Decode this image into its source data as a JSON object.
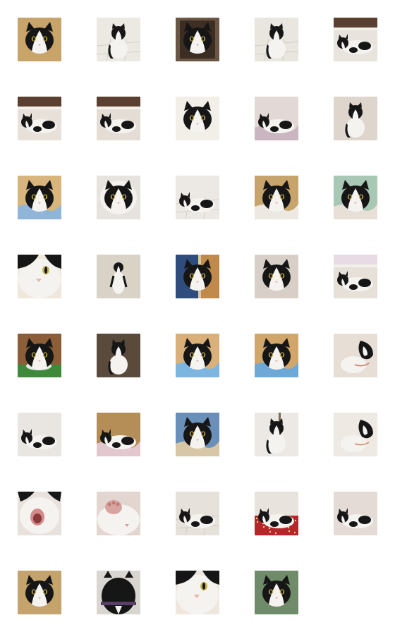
{
  "grid": {
    "columns": 5,
    "rows": 8,
    "items": [
      {
        "id": 1,
        "scene": "bg",
        "bg": "#c9a46a",
        "cat": "face",
        "accent": "#d9462f"
      },
      {
        "id": 2,
        "scene": "tile",
        "bg": "#ece8e2",
        "cat": "sit",
        "accent": "#6b5a49"
      },
      {
        "id": 3,
        "scene": "box",
        "bg": "#6a5645",
        "cat": "face",
        "accent": "#8f7457"
      },
      {
        "id": 4,
        "scene": "tile",
        "bg": "#e9e5df",
        "cat": "sit",
        "accent": "#b32d2d"
      },
      {
        "id": 5,
        "scene": "wall",
        "bg": "#e8e3dd",
        "cat": "lie",
        "accent": "#5b3f30"
      },
      {
        "id": 6,
        "scene": "wall",
        "bg": "#e7e1da",
        "cat": "lie",
        "accent": "#5b3f30"
      },
      {
        "id": 7,
        "scene": "wall",
        "bg": "#e4ddd5",
        "cat": "lie",
        "accent": "#5b3f30"
      },
      {
        "id": 8,
        "scene": "bg",
        "bg": "#f2efe9",
        "cat": "face",
        "accent": "#3a6aa8"
      },
      {
        "id": 9,
        "scene": "blanket",
        "bg": "#e2d8d6",
        "cat": "lie",
        "accent": "#c9b6c0"
      },
      {
        "id": 10,
        "scene": "bg",
        "bg": "#ded6cc",
        "cat": "sit",
        "accent": "#8b8b8b"
      },
      {
        "id": 11,
        "scene": "blanket",
        "bg": "#d8b57c",
        "cat": "face",
        "accent": "#8fb6d9"
      },
      {
        "id": 12,
        "scene": "tunnel",
        "bg": "#e6e2de",
        "cat": "face",
        "accent": "#cfcac4"
      },
      {
        "id": 13,
        "scene": "tile",
        "bg": "#ece9e4",
        "cat": "lie",
        "accent": "#6f7b8a"
      },
      {
        "id": 14,
        "scene": "blanket",
        "bg": "#c6a46c",
        "cat": "face",
        "accent": "#ede8e1"
      },
      {
        "id": 15,
        "scene": "blanket",
        "bg": "#a9c7b5",
        "cat": "face",
        "accent": "#e8e0d6"
      },
      {
        "id": 16,
        "scene": "close",
        "bg": "#efe6dc",
        "cat": "close",
        "accent": "#e9b3b0"
      },
      {
        "id": 17,
        "scene": "bg",
        "bg": "#d9d2c6",
        "cat": "stand",
        "accent": "#9c9186"
      },
      {
        "id": 18,
        "scene": "door",
        "bg": "#2f4d7c",
        "cat": "face",
        "accent": "#c08a4a"
      },
      {
        "id": 19,
        "scene": "bg",
        "bg": "#d8d0c8",
        "cat": "face",
        "accent": "#c22c3d"
      },
      {
        "id": 20,
        "scene": "wall",
        "bg": "#e6e0d8",
        "cat": "lie",
        "accent": "#e9dbe6"
      },
      {
        "id": 21,
        "scene": "bowl",
        "bg": "#8b5e38",
        "cat": "face",
        "accent": "#3f8a3a"
      },
      {
        "id": 22,
        "scene": "bg",
        "bg": "#5a4a3c",
        "cat": "sit",
        "accent": "#e84a8c"
      },
      {
        "id": 23,
        "scene": "blanket",
        "bg": "#d9b07a",
        "cat": "face",
        "accent": "#7bb5e0"
      },
      {
        "id": 24,
        "scene": "blanket",
        "bg": "#d0a66a",
        "cat": "face",
        "accent": "#6da8d6"
      },
      {
        "id": 25,
        "scene": "bg",
        "bg": "#e7ded6",
        "cat": "lookup",
        "accent": "#c7745a"
      },
      {
        "id": 26,
        "scene": "bg",
        "bg": "#e9e6e2",
        "cat": "lie",
        "accent": "#bdb7ae"
      },
      {
        "id": 27,
        "scene": "blanket",
        "bg": "#b58d57",
        "cat": "lie",
        "accent": "#e3c7cf"
      },
      {
        "id": 28,
        "scene": "blanket",
        "bg": "#6a8fb8",
        "cat": "face",
        "accent": "#d8c7a6"
      },
      {
        "id": 29,
        "scene": "pole",
        "bg": "#ece8e3",
        "cat": "sit",
        "accent": "#7a6a5a"
      },
      {
        "id": 30,
        "scene": "bg",
        "bg": "#efe9e4",
        "cat": "lookup",
        "accent": "#d08a5e"
      },
      {
        "id": 31,
        "scene": "close",
        "bg": "#e9e2dc",
        "cat": "yawn",
        "accent": "#d28b8b"
      },
      {
        "id": 32,
        "scene": "close",
        "bg": "#e3d5cf",
        "cat": "paw",
        "accent": "#d8a4a0"
      },
      {
        "id": 33,
        "scene": "tile",
        "bg": "#e6e1da",
        "cat": "lie",
        "accent": "#6a5848"
      },
      {
        "id": 34,
        "scene": "rug",
        "bg": "#e8e3dd",
        "cat": "lie",
        "accent": "#b7242a"
      },
      {
        "id": 35,
        "scene": "bg",
        "bg": "#e4dbd6",
        "cat": "lie",
        "accent": "#7d3a30"
      },
      {
        "id": 36,
        "scene": "bg",
        "bg": "#c5a36c",
        "cat": "face",
        "accent": "#2f6f9a"
      },
      {
        "id": 37,
        "scene": "close",
        "bg": "#d9d6d2",
        "cat": "back",
        "accent": "#5a3f6a"
      },
      {
        "id": 38,
        "scene": "close",
        "bg": "#efe6de",
        "cat": "close",
        "accent": "#e6b2a6"
      },
      {
        "id": 39,
        "scene": "bg",
        "bg": "#6f8b6a",
        "cat": "face",
        "accent": "#3e3e3e"
      }
    ]
  }
}
